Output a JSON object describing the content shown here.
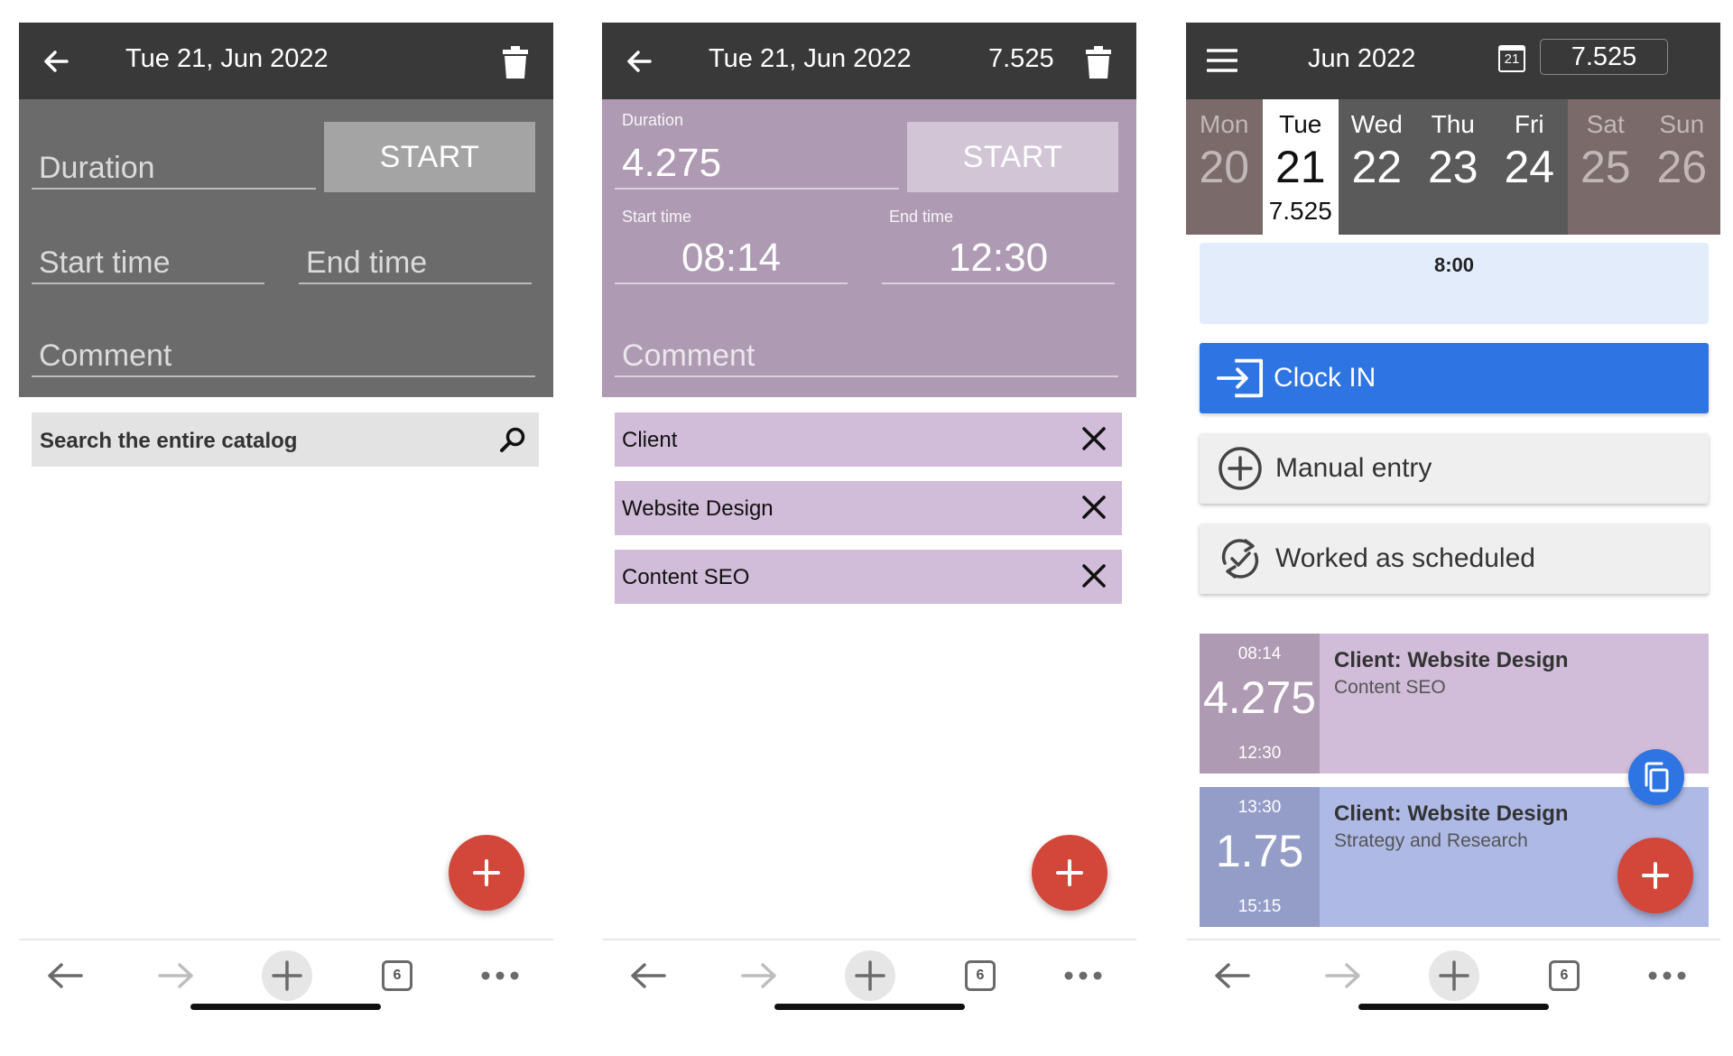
{
  "screen1": {
    "header": {
      "title": "Tue 21, Jun 2022",
      "back_icon": "arrow-left-icon",
      "delete_icon": "trash-icon"
    },
    "form": {
      "duration_placeholder": "Duration",
      "start_button": "START",
      "start_time_placeholder": "Start time",
      "end_time_placeholder": "End time",
      "comment_placeholder": "Comment"
    },
    "search": {
      "placeholder": "Search the entire catalog",
      "icon": "search-icon"
    },
    "fab_icon": "plus-icon"
  },
  "screen2": {
    "header": {
      "title": "Tue 21, Jun 2022",
      "total": "7.525",
      "back_icon": "arrow-left-icon",
      "delete_icon": "trash-icon"
    },
    "form": {
      "duration_label": "Duration",
      "duration_value": "4.275",
      "start_button": "START",
      "start_time_label": "Start time",
      "start_time_value": "08:14",
      "end_time_label": "End time",
      "end_time_value": "12:30",
      "comment_placeholder": "Comment"
    },
    "tags": [
      {
        "label": "Client"
      },
      {
        "label": "Website Design"
      },
      {
        "label": "Content SEO"
      }
    ],
    "fab_icon": "plus-icon"
  },
  "screen3": {
    "header": {
      "title": "Jun 2022",
      "total": "7.525",
      "calendar_badge": "21",
      "menu_icon": "hamburger-menu-icon"
    },
    "week": [
      {
        "name": "Mon",
        "date": "20",
        "hours": "",
        "kind": "weekend"
      },
      {
        "name": "Tue",
        "date": "21",
        "hours": "7.525",
        "kind": "selected"
      },
      {
        "name": "Wed",
        "date": "22",
        "hours": "",
        "kind": "work"
      },
      {
        "name": "Thu",
        "date": "23",
        "hours": "",
        "kind": "work"
      },
      {
        "name": "Fri",
        "date": "24",
        "hours": "",
        "kind": "work"
      },
      {
        "name": "Sat",
        "date": "25",
        "hours": "",
        "kind": "weekend"
      },
      {
        "name": "Sun",
        "date": "26",
        "hours": "",
        "kind": "weekend"
      }
    ],
    "schedule": {
      "time": "8:00"
    },
    "actions": {
      "clock_in": "Clock IN",
      "manual_entry": "Manual entry",
      "worked_as_scheduled": "Worked as scheduled"
    },
    "entries": [
      {
        "start": "08:14",
        "duration": "4.275",
        "end": "12:30",
        "title": "Client: Website Design",
        "subtitle": "Content SEO"
      },
      {
        "start": "13:30",
        "duration": "1.75",
        "end": "15:15",
        "title": "Client: Website Design",
        "subtitle": "Strategy and Research"
      }
    ]
  },
  "bottom_nav": {
    "tab_count": "6",
    "icons": [
      "back-arrow-icon",
      "forward-arrow-icon",
      "new-tab-plus-icon",
      "tabs-icon",
      "more-dots-icon"
    ]
  },
  "colors": {
    "header_bg": "#393939",
    "form_empty_bg": "#6b6b6b",
    "form_filled_bg": "#ae9ab2",
    "tag_bg": "#d1bcd9",
    "fab_red": "#d2473a",
    "clock_in_blue": "#2e74e3",
    "entry1_side": "#ae9ab2",
    "entry1_body": "#d1bcd9",
    "entry2_side": "#949dc7",
    "entry2_body": "#aeb9e6"
  }
}
